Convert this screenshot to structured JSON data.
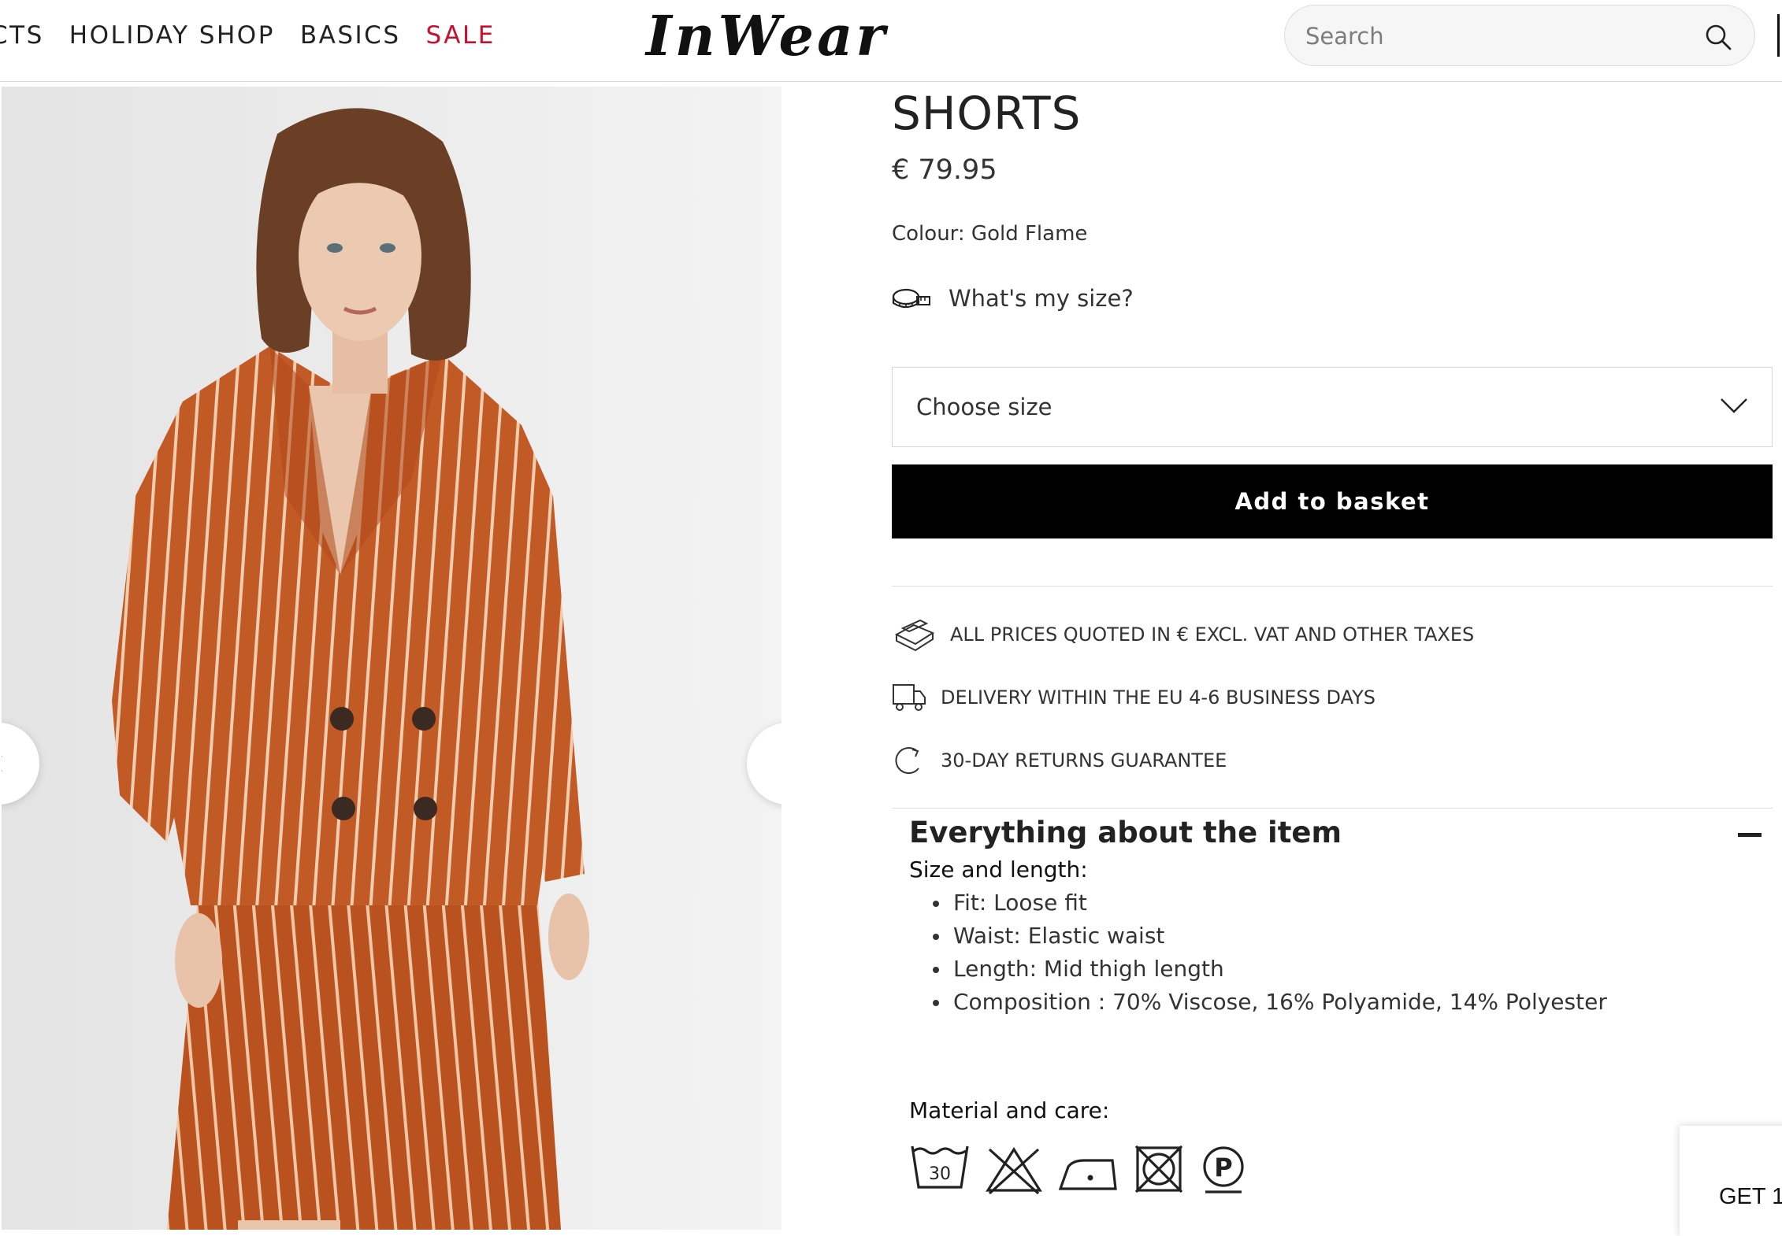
{
  "header": {
    "nav_items": [
      {
        "label": "CTS"
      },
      {
        "label": "HOLIDAY SHOP"
      },
      {
        "label": "BASICS"
      },
      {
        "label": "SALE"
      }
    ],
    "logo": "InWear",
    "search_placeholder": "Search"
  },
  "product": {
    "title": "SHORTS",
    "price": "€ 79.95",
    "colour": "Colour: Gold Flame",
    "size_guide": "What's my size?",
    "size_select": "Choose size",
    "add_to_basket": "Add to basket"
  },
  "usps": [
    {
      "icon": "box-icon",
      "text": "ALL PRICES QUOTED IN € EXCL. VAT AND OTHER TAXES"
    },
    {
      "icon": "truck-icon",
      "text": "DELIVERY WITHIN THE EU 4-6 BUSINESS DAYS"
    },
    {
      "icon": "return-icon",
      "text": "30-DAY RETURNS GUARANTEE"
    }
  ],
  "details": {
    "title": "Everything about the item",
    "size_heading": "Size and length:",
    "specs": [
      "Fit: Loose fit",
      "Waist: Elastic waist",
      "Length: Mid thigh length",
      "Composition : 70% Viscose, 16% Polyamide, 14% Polyester"
    ],
    "care_heading": "Material and care:",
    "care_icons": [
      "wash-30-icon",
      "no-bleach-icon",
      "iron-low-icon",
      "no-tumble-dry-icon",
      "dry-clean-p-icon"
    ],
    "wash_temp": "30",
    "dry_clean_letter": "P"
  },
  "promo": {
    "label": "GET 1"
  },
  "colors": {
    "sale": "#c8102e",
    "button": "#000000",
    "garment": "#c25a26"
  }
}
